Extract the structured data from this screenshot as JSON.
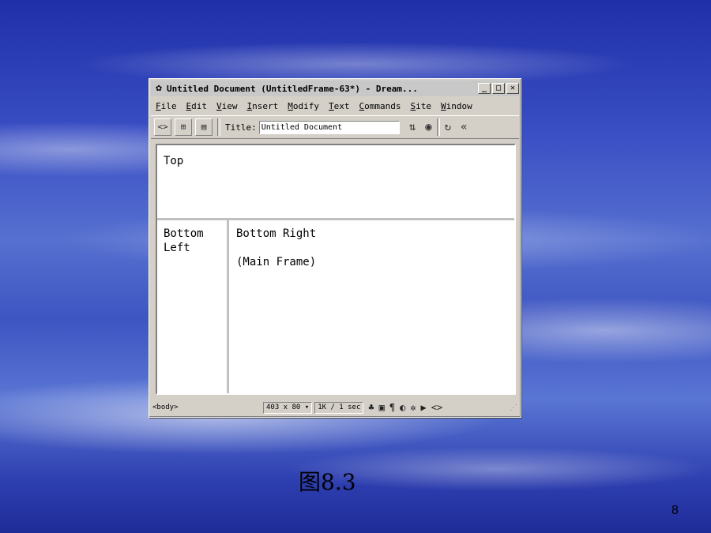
{
  "window": {
    "title": "Untitled Document (UntitledFrame-63*) - Dream...",
    "app_icon": "dreamweaver-icon",
    "controls": [
      "_",
      "□",
      "✕"
    ]
  },
  "menu": {
    "items": [
      "File",
      "Edit",
      "View",
      "Insert",
      "Modify",
      "Text",
      "Commands",
      "Site",
      "Window"
    ]
  },
  "toolbar": {
    "title_label": "Title:",
    "title_value": "Untitled Document",
    "tool_icons": [
      "code-view-icon",
      "split-view-icon",
      "design-view-icon",
      "file-transfer-icon",
      "preview-browser-icon",
      "refresh-icon",
      "reference-icon"
    ]
  },
  "frames": {
    "top": "Top",
    "bottom_left": "Bottom\nLeft",
    "bottom_right": "Bottom Right\n\n(Main Frame)"
  },
  "statusbar": {
    "tag": "<body>",
    "window_size": "403 x 80 ▾",
    "download": "1K / 1 sec"
  },
  "slide": {
    "caption": "图8.3",
    "page_number": "8"
  }
}
